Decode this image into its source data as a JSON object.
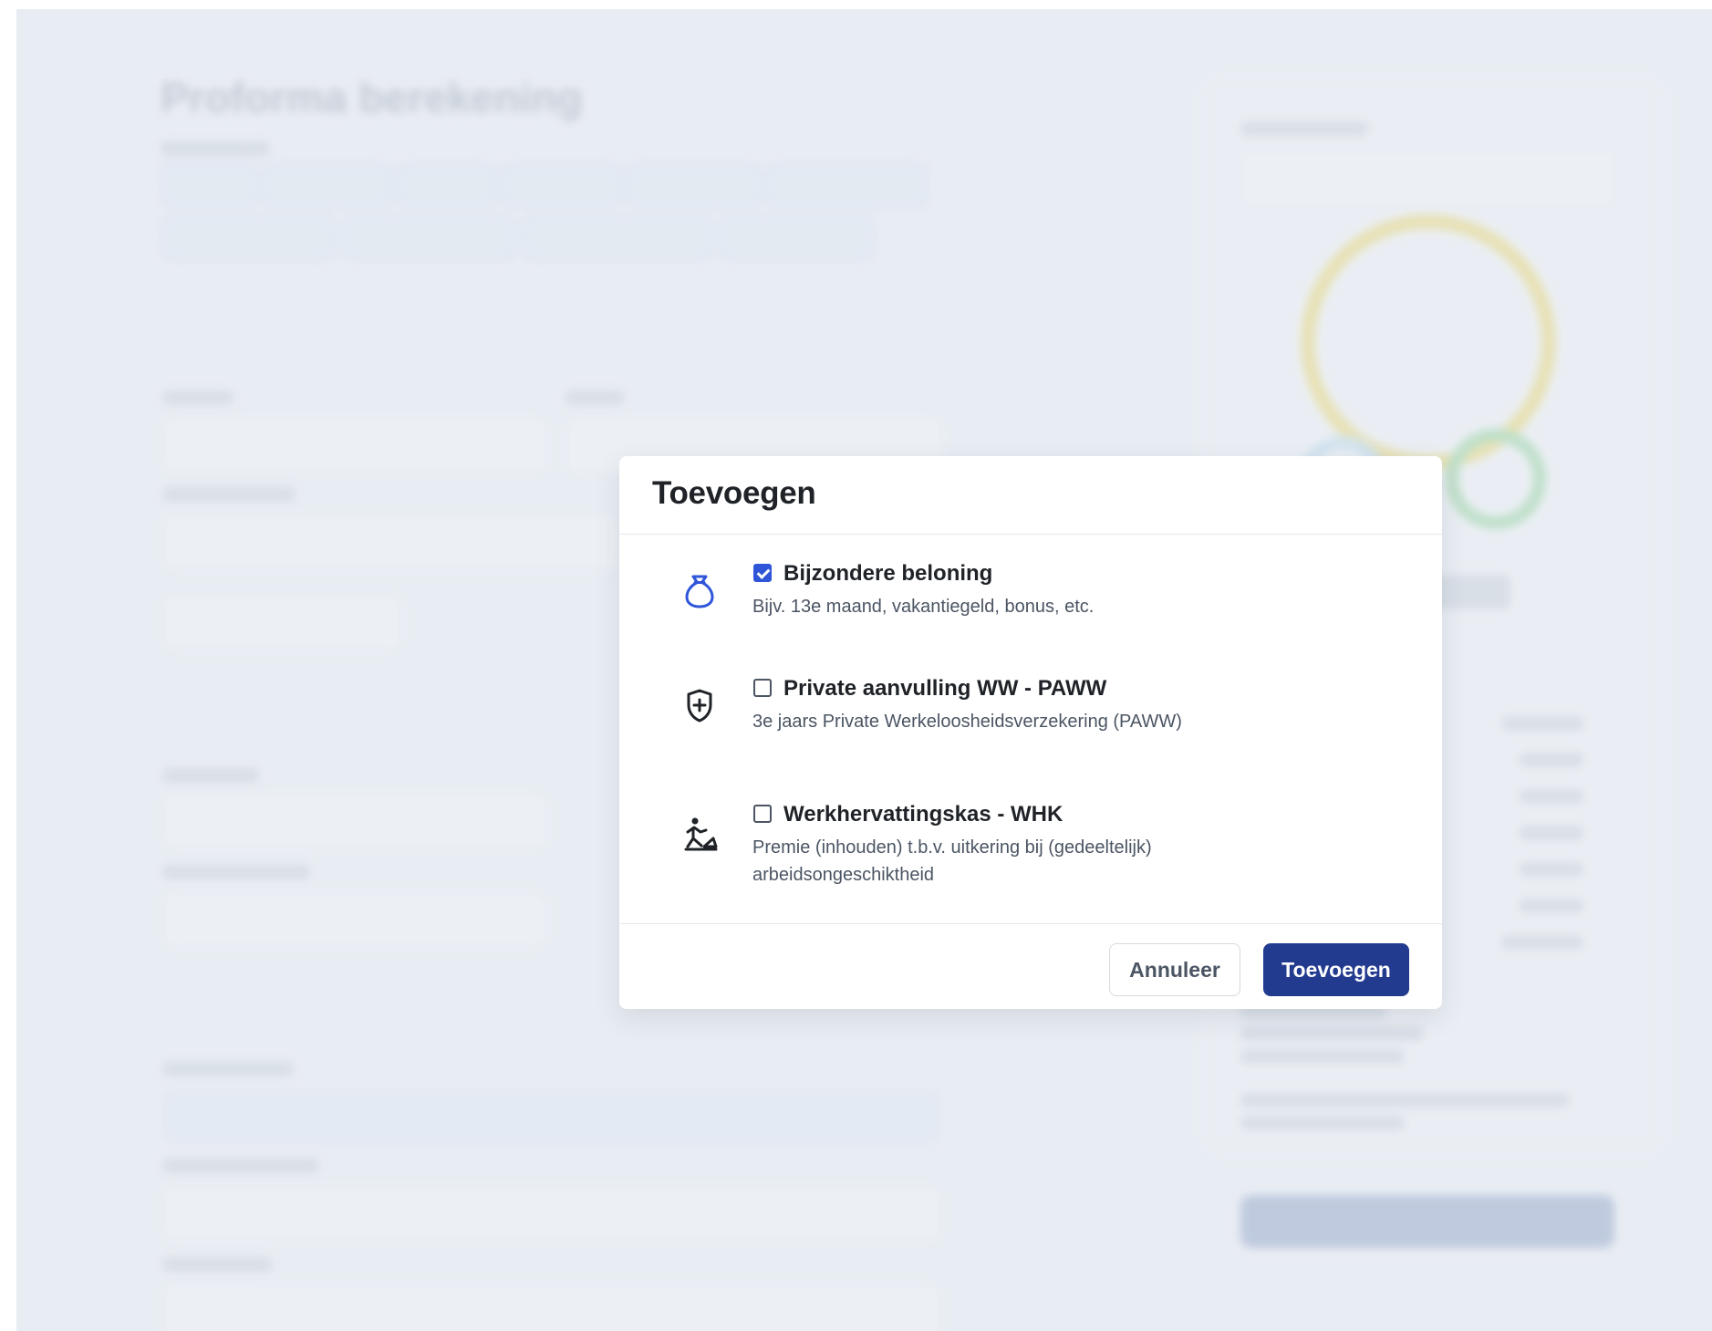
{
  "page": {
    "background_title": "Proforma berekening"
  },
  "modal": {
    "title": "Toevoegen",
    "options": [
      {
        "title": "Bijzondere beloning",
        "description": "Bijv. 13e maand, vakantiegeld, bonus, etc.",
        "checked": true,
        "icon": "money-bag-icon"
      },
      {
        "title": "Private aanvulling WW - PAWW",
        "description": "3e jaars Private Werkeloosheidsverzekering (PAWW)",
        "checked": false,
        "icon": "shield-plus-icon"
      },
      {
        "title": "Werkhervattingskas - WHK",
        "description": "Premie (inhouden) t.b.v. uitkering bij (gedeeltelijk) arbeidsongeschiktheid",
        "checked": false,
        "icon": "worker-icon"
      }
    ],
    "buttons": {
      "cancel": "Annuleer",
      "confirm": "Toevoegen"
    }
  },
  "colors": {
    "primary": "#233b8f",
    "checkbox": "#2f56d9",
    "overlay": "#e9edf3"
  }
}
